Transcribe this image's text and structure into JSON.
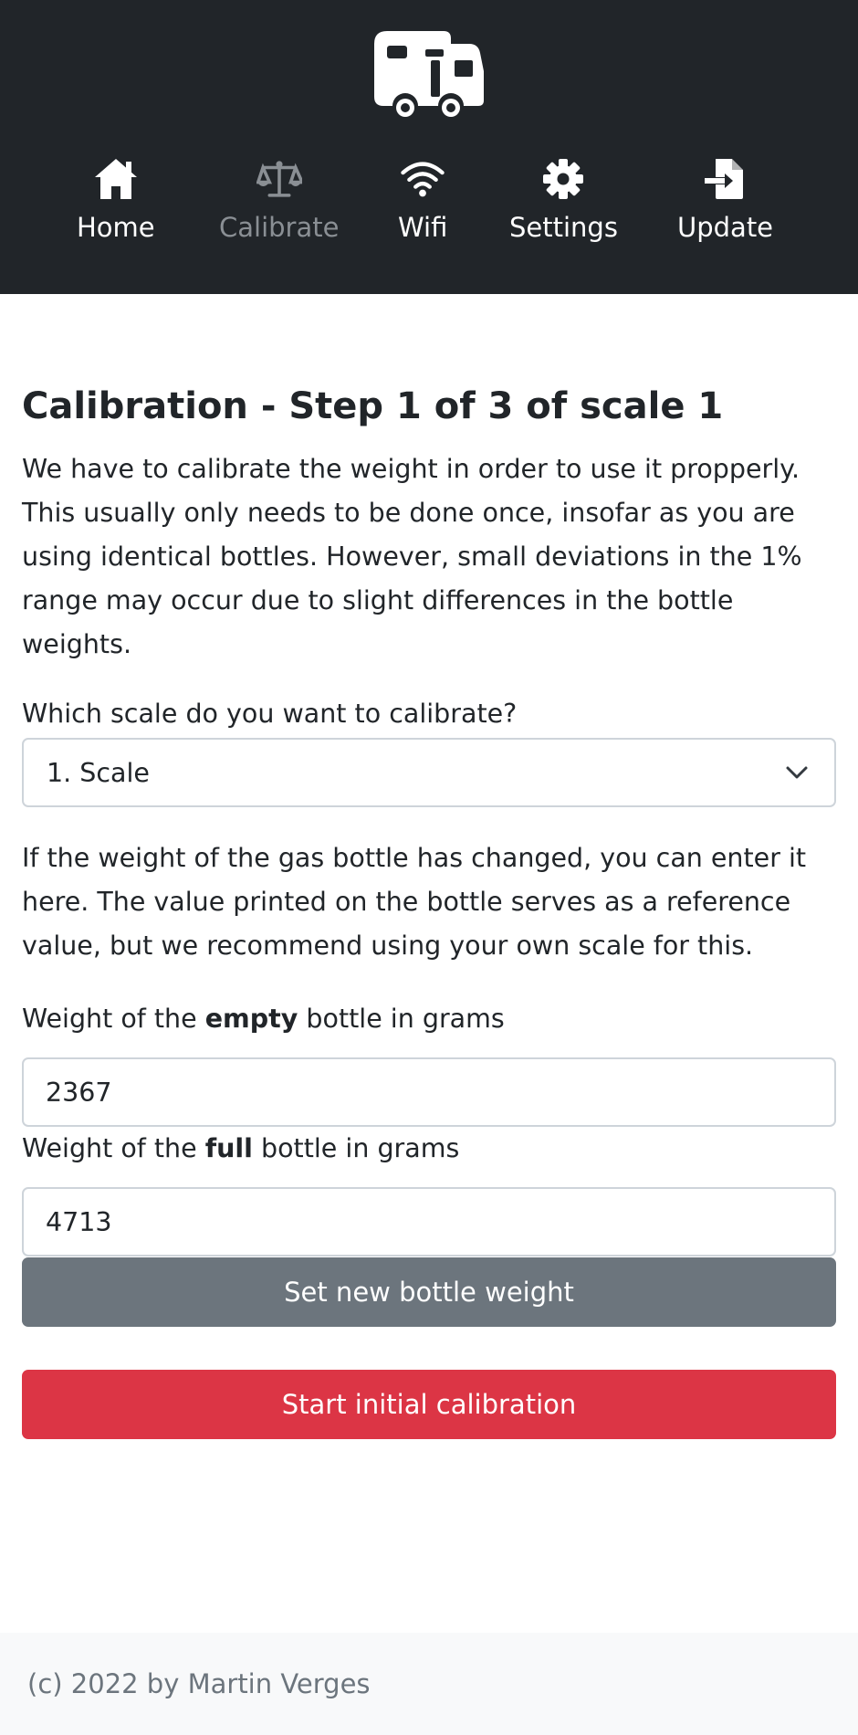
{
  "nav": {
    "items": [
      {
        "label": "Home",
        "icon": "home-icon"
      },
      {
        "label": "Calibrate",
        "icon": "scale-icon",
        "active": true
      },
      {
        "label": "Wifi",
        "icon": "wifi-icon"
      },
      {
        "label": "Settings",
        "icon": "gear-icon"
      },
      {
        "label": "Update",
        "icon": "file-import-icon"
      }
    ],
    "logo": "camper-truck-icon"
  },
  "main": {
    "title": "Calibration - Step 1 of 3 of scale 1",
    "intro": "We have to calibrate the weight in order to use it propperly. This usually only needs to be done once, insofar as you are using identical bottles. However, small deviations in the 1% range may occur due to slight differences in the bottle weights.",
    "scale_question": "Which scale do you want to calibrate?",
    "scale_select": {
      "selected": "1. Scale"
    },
    "weight_info": "If the weight of the gas bottle has changed, you can enter it here. The value printed on the bottle serves as a reference value, but we recommend using your own scale for this.",
    "empty": {
      "pre": "Weight of the ",
      "bold": "empty",
      "post": " bottle in grams",
      "value": "2367"
    },
    "full": {
      "pre": "Weight of the ",
      "bold": "full",
      "post": " bottle in grams",
      "value": "4713"
    },
    "set_weight_button": "Set new bottle weight",
    "start_calibration_button": "Start initial calibration"
  },
  "footer": {
    "text": "(c) 2022 by Martin Verges"
  },
  "colors": {
    "navbar": "#212529",
    "secondary": "#6c757d",
    "danger": "#dc3545",
    "footer_bg": "#f8f9fa"
  }
}
